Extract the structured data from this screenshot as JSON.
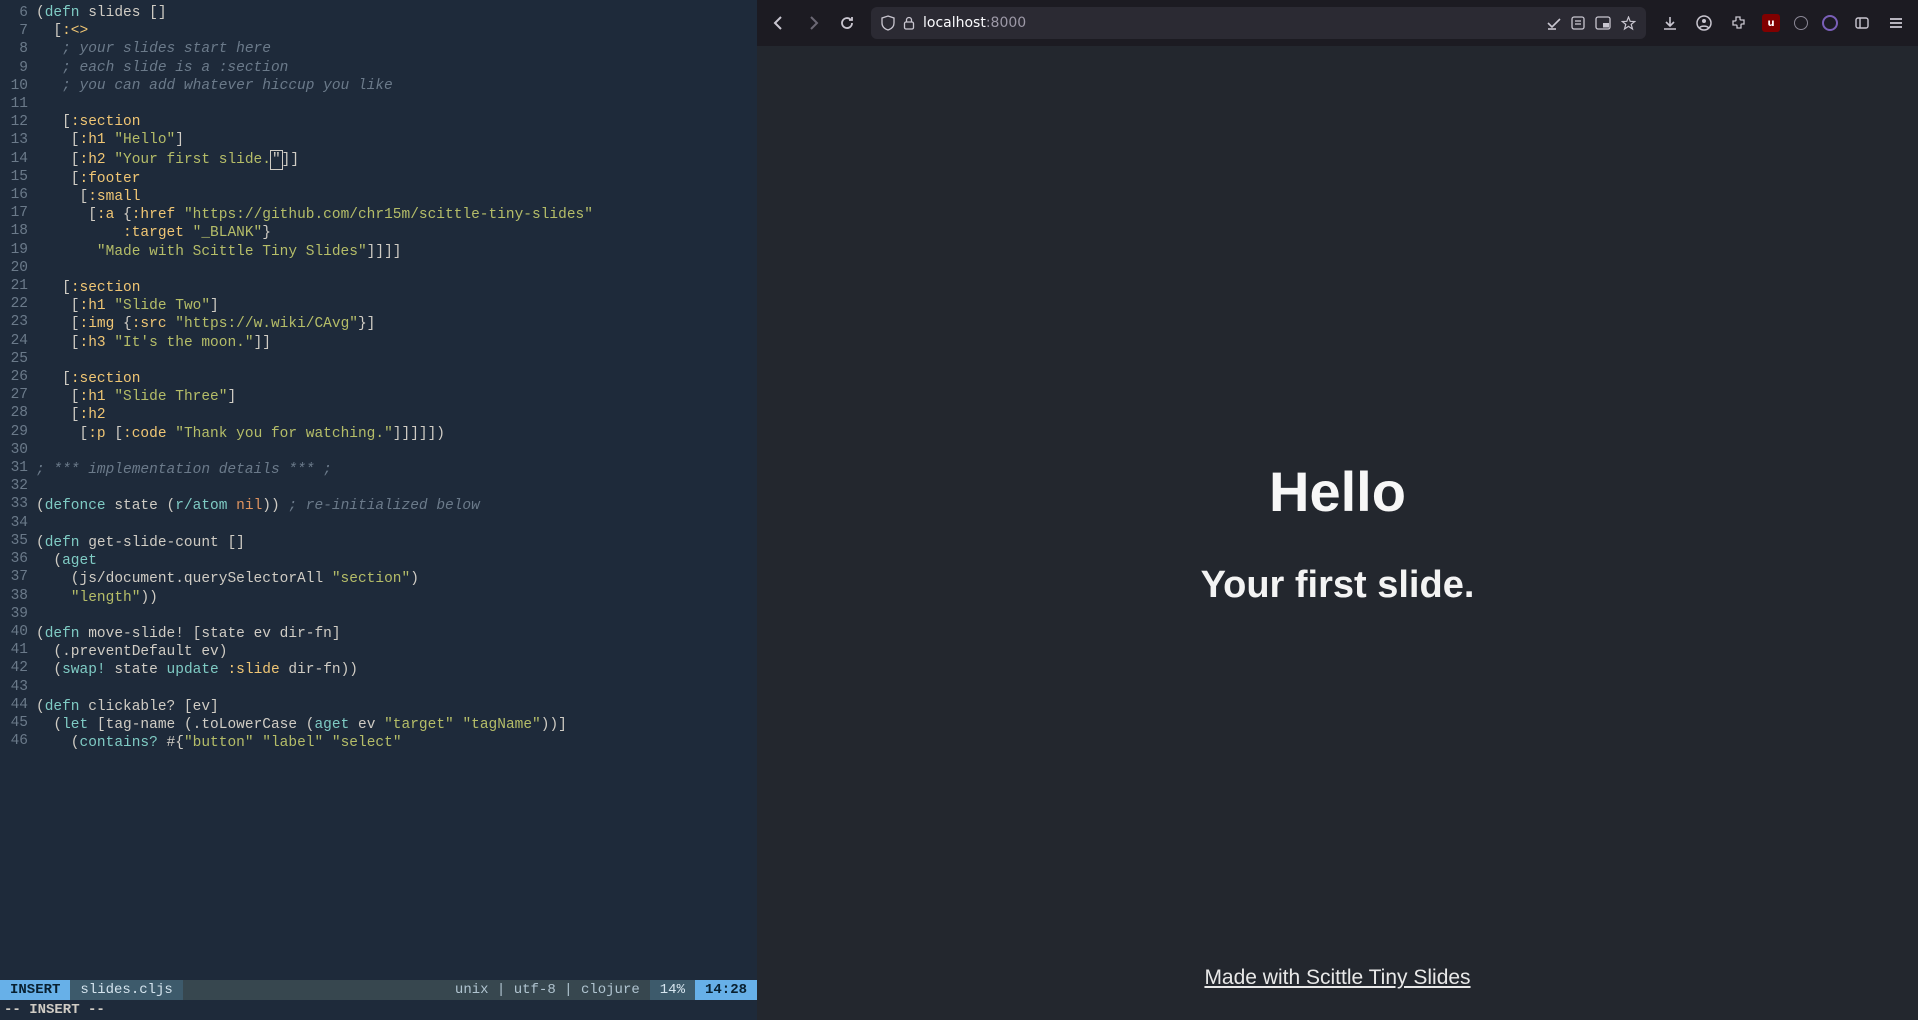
{
  "editor": {
    "statusline": {
      "mode": "INSERT",
      "filename": "slides.cljs",
      "encoding": "unix  |  utf-8  |  clojure",
      "percent": "14%",
      "position": "14:28"
    },
    "cmdline": "-- INSERT --",
    "lines": [
      {
        "n": 6,
        "tokens": [
          [
            "p",
            "("
          ],
          [
            "kw",
            "defn"
          ],
          [
            "p",
            " "
          ],
          [
            "sym",
            "slides"
          ],
          [
            "p",
            " []"
          ]
        ]
      },
      {
        "n": 7,
        "tokens": [
          [
            "p",
            "  ["
          ],
          [
            "key",
            ":<>"
          ]
        ]
      },
      {
        "n": 8,
        "tokens": [
          [
            "p",
            "   "
          ],
          [
            "cm",
            "; your slides start here"
          ]
        ]
      },
      {
        "n": 9,
        "tokens": [
          [
            "p",
            "   "
          ],
          [
            "cm",
            "; each slide is a :section"
          ]
        ]
      },
      {
        "n": 10,
        "tokens": [
          [
            "p",
            "   "
          ],
          [
            "cm",
            "; you can add whatever hiccup you like"
          ]
        ]
      },
      {
        "n": 11,
        "tokens": []
      },
      {
        "n": 12,
        "tokens": [
          [
            "p",
            "   ["
          ],
          [
            "key",
            ":section"
          ]
        ]
      },
      {
        "n": 13,
        "tokens": [
          [
            "p",
            "    ["
          ],
          [
            "key",
            ":h1"
          ],
          [
            "p",
            " "
          ],
          [
            "str",
            "\"Hello\""
          ],
          [
            "p",
            "]"
          ]
        ]
      },
      {
        "n": 14,
        "tokens": [
          [
            "p",
            "    ["
          ],
          [
            "key",
            ":h2"
          ],
          [
            "p",
            " "
          ],
          [
            "str",
            "\"Your first slide."
          ],
          [
            "cursor",
            "\""
          ],
          [
            "p",
            "]]"
          ]
        ]
      },
      {
        "n": 15,
        "tokens": [
          [
            "p",
            "    ["
          ],
          [
            "key",
            ":footer"
          ]
        ]
      },
      {
        "n": 16,
        "tokens": [
          [
            "p",
            "     ["
          ],
          [
            "key",
            ":small"
          ]
        ]
      },
      {
        "n": 17,
        "tokens": [
          [
            "p",
            "      ["
          ],
          [
            "key",
            ":a"
          ],
          [
            "p",
            " {"
          ],
          [
            "key",
            ":href"
          ],
          [
            "p",
            " "
          ],
          [
            "str",
            "\"https://github.com/chr15m/scittle-tiny-slides\""
          ]
        ]
      },
      {
        "n": 18,
        "tokens": [
          [
            "p",
            "          "
          ],
          [
            "key",
            ":target"
          ],
          [
            "p",
            " "
          ],
          [
            "str",
            "\"_BLANK\""
          ],
          [
            "p",
            "}"
          ]
        ]
      },
      {
        "n": 19,
        "tokens": [
          [
            "p",
            "       "
          ],
          [
            "str",
            "\"Made with Scittle Tiny Slides\""
          ],
          [
            "p",
            "]]]]"
          ]
        ]
      },
      {
        "n": 20,
        "tokens": []
      },
      {
        "n": 21,
        "tokens": [
          [
            "p",
            "   ["
          ],
          [
            "key",
            ":section"
          ]
        ]
      },
      {
        "n": 22,
        "tokens": [
          [
            "p",
            "    ["
          ],
          [
            "key",
            ":h1"
          ],
          [
            "p",
            " "
          ],
          [
            "str",
            "\"Slide Two\""
          ],
          [
            "p",
            "]"
          ]
        ]
      },
      {
        "n": 23,
        "tokens": [
          [
            "p",
            "    ["
          ],
          [
            "key",
            ":img"
          ],
          [
            "p",
            " {"
          ],
          [
            "key",
            ":src"
          ],
          [
            "p",
            " "
          ],
          [
            "str",
            "\"https://w.wiki/CAvg\""
          ],
          [
            "p",
            "}]"
          ]
        ]
      },
      {
        "n": 24,
        "tokens": [
          [
            "p",
            "    ["
          ],
          [
            "key",
            ":h3"
          ],
          [
            "p",
            " "
          ],
          [
            "str",
            "\"It's the moon.\""
          ],
          [
            "p",
            "]]"
          ]
        ]
      },
      {
        "n": 25,
        "tokens": []
      },
      {
        "n": 26,
        "tokens": [
          [
            "p",
            "   ["
          ],
          [
            "key",
            ":section"
          ]
        ]
      },
      {
        "n": 27,
        "tokens": [
          [
            "p",
            "    ["
          ],
          [
            "key",
            ":h1"
          ],
          [
            "p",
            " "
          ],
          [
            "str",
            "\"Slide Three\""
          ],
          [
            "p",
            "]"
          ]
        ]
      },
      {
        "n": 28,
        "tokens": [
          [
            "p",
            "    ["
          ],
          [
            "key",
            ":h2"
          ]
        ]
      },
      {
        "n": 29,
        "tokens": [
          [
            "p",
            "     ["
          ],
          [
            "key",
            ":p"
          ],
          [
            "p",
            " ["
          ],
          [
            "key",
            ":code"
          ],
          [
            "p",
            " "
          ],
          [
            "str",
            "\"Thank you for watching.\""
          ],
          [
            "p",
            "]]]]])"
          ]
        ]
      },
      {
        "n": 30,
        "tokens": []
      },
      {
        "n": 31,
        "tokens": [
          [
            "cm",
            "; *** implementation details *** ;"
          ]
        ]
      },
      {
        "n": 32,
        "tokens": []
      },
      {
        "n": 33,
        "tokens": [
          [
            "p",
            "("
          ],
          [
            "kw",
            "defonce"
          ],
          [
            "p",
            " "
          ],
          [
            "sym",
            "state"
          ],
          [
            "p",
            " ("
          ],
          [
            "fn",
            "r/atom"
          ],
          [
            "p",
            " "
          ],
          [
            "nilc",
            "nil"
          ],
          [
            "p",
            ")) "
          ],
          [
            "cm",
            "; re-initialized below"
          ]
        ]
      },
      {
        "n": 34,
        "tokens": []
      },
      {
        "n": 35,
        "tokens": [
          [
            "p",
            "("
          ],
          [
            "kw",
            "defn"
          ],
          [
            "p",
            " "
          ],
          [
            "sym",
            "get-slide-count"
          ],
          [
            "p",
            " []"
          ]
        ]
      },
      {
        "n": 36,
        "tokens": [
          [
            "p",
            "  ("
          ],
          [
            "fn",
            "aget"
          ]
        ]
      },
      {
        "n": 37,
        "tokens": [
          [
            "p",
            "    ("
          ],
          [
            "sym",
            "js/document.querySelectorAll"
          ],
          [
            "p",
            " "
          ],
          [
            "str",
            "\"section\""
          ],
          [
            "p",
            ")"
          ]
        ]
      },
      {
        "n": 38,
        "tokens": [
          [
            "p",
            "    "
          ],
          [
            "str",
            "\"length\""
          ],
          [
            "p",
            "))"
          ]
        ]
      },
      {
        "n": 39,
        "tokens": []
      },
      {
        "n": 40,
        "tokens": [
          [
            "p",
            "("
          ],
          [
            "kw",
            "defn"
          ],
          [
            "p",
            " "
          ],
          [
            "sym",
            "move-slide!"
          ],
          [
            "p",
            " ["
          ],
          [
            "sym",
            "state"
          ],
          [
            "p",
            " "
          ],
          [
            "sym",
            "ev"
          ],
          [
            "p",
            " "
          ],
          [
            "sym",
            "dir-fn"
          ],
          [
            "p",
            "]"
          ]
        ]
      },
      {
        "n": 41,
        "tokens": [
          [
            "p",
            "  ("
          ],
          [
            "sym",
            ".preventDefault"
          ],
          [
            "p",
            " "
          ],
          [
            "sym",
            "ev"
          ],
          [
            "p",
            ")"
          ]
        ]
      },
      {
        "n": 42,
        "tokens": [
          [
            "p",
            "  ("
          ],
          [
            "fn",
            "swap!"
          ],
          [
            "p",
            " "
          ],
          [
            "sym",
            "state"
          ],
          [
            "p",
            " "
          ],
          [
            "fn",
            "update"
          ],
          [
            "p",
            " "
          ],
          [
            "key",
            ":slide"
          ],
          [
            "p",
            " "
          ],
          [
            "sym",
            "dir-fn"
          ],
          [
            "p",
            "))"
          ]
        ]
      },
      {
        "n": 43,
        "tokens": []
      },
      {
        "n": 44,
        "tokens": [
          [
            "p",
            "("
          ],
          [
            "kw",
            "defn"
          ],
          [
            "p",
            " "
          ],
          [
            "sym",
            "clickable?"
          ],
          [
            "p",
            " ["
          ],
          [
            "sym",
            "ev"
          ],
          [
            "p",
            "]"
          ]
        ]
      },
      {
        "n": 45,
        "tokens": [
          [
            "p",
            "  ("
          ],
          [
            "kw",
            "let"
          ],
          [
            "p",
            " ["
          ],
          [
            "sym",
            "tag-name"
          ],
          [
            "p",
            " ("
          ],
          [
            "sym",
            ".toLowerCase"
          ],
          [
            "p",
            " ("
          ],
          [
            "fn",
            "aget"
          ],
          [
            "p",
            " "
          ],
          [
            "sym",
            "ev"
          ],
          [
            "p",
            " "
          ],
          [
            "str",
            "\"target\""
          ],
          [
            "p",
            " "
          ],
          [
            "str",
            "\"tagName\""
          ],
          [
            "p",
            "))]"
          ]
        ]
      },
      {
        "n": 46,
        "tokens": [
          [
            "p",
            "    ("
          ],
          [
            "fn",
            "contains?"
          ],
          [
            "p",
            " #{"
          ],
          [
            "str",
            "\"button\""
          ],
          [
            "p",
            " "
          ],
          [
            "str",
            "\"label\""
          ],
          [
            "p",
            " "
          ],
          [
            "str",
            "\"select\""
          ]
        ]
      }
    ]
  },
  "browser": {
    "url_host": "localhost",
    "url_port": ":8000",
    "page": {
      "h1": "Hello",
      "h2": "Your first slide.",
      "footer_link": "Made with Scittle Tiny Slides"
    }
  }
}
